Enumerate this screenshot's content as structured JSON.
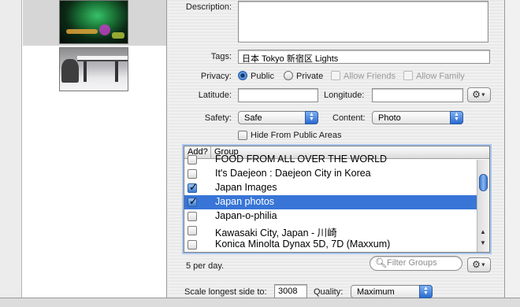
{
  "labels": {
    "description": "Description:",
    "tags": "Tags:",
    "privacy": "Privacy:",
    "latitude": "Latitude:",
    "longitude": "Longitude:",
    "safety": "Safety:",
    "content": "Content:",
    "scale": "Scale longest side to:",
    "quality": "Quality:"
  },
  "fields": {
    "description": "",
    "tags": "日本 Tokyo 新宿区 Lights",
    "latitude": "",
    "longitude": "",
    "scale": "3008"
  },
  "privacy": {
    "options": [
      "Public",
      "Private"
    ],
    "selected": "Public",
    "allow_friends": "Allow Friends",
    "allow_family": "Allow Family"
  },
  "safety": {
    "selected": "Safe"
  },
  "content": {
    "selected": "Photo"
  },
  "hide_public": "Hide From Public Areas",
  "quality": {
    "selected": "Maximum"
  },
  "group_list": {
    "columns": [
      "Add?",
      "Group"
    ],
    "rows": [
      {
        "name": "FOOD FROM ALL OVER THE WORLD",
        "checked": false,
        "selected": false
      },
      {
        "name": "It's Daejeon : Daejeon City in Korea",
        "checked": false,
        "selected": false
      },
      {
        "name": "Japan Images",
        "checked": true,
        "selected": false
      },
      {
        "name": "Japan photos",
        "checked": true,
        "selected": true
      },
      {
        "name": "Japan-o-philia",
        "checked": false,
        "selected": false
      },
      {
        "name": "Kawasaki City, Japan - 川崎",
        "checked": false,
        "selected": false
      },
      {
        "name": "Konica Minolta Dynax 5D, 7D (Maxxum)",
        "checked": false,
        "selected": false
      }
    ]
  },
  "per_day": "5 per day.",
  "filter": {
    "placeholder": "Filter Groups"
  },
  "icons": {
    "gear": "gear-icon",
    "search": "magnifier-icon",
    "checkmark": "checkmark-icon"
  },
  "colors": {
    "selection": "#3875d7",
    "accent": "#2f6cc0"
  }
}
